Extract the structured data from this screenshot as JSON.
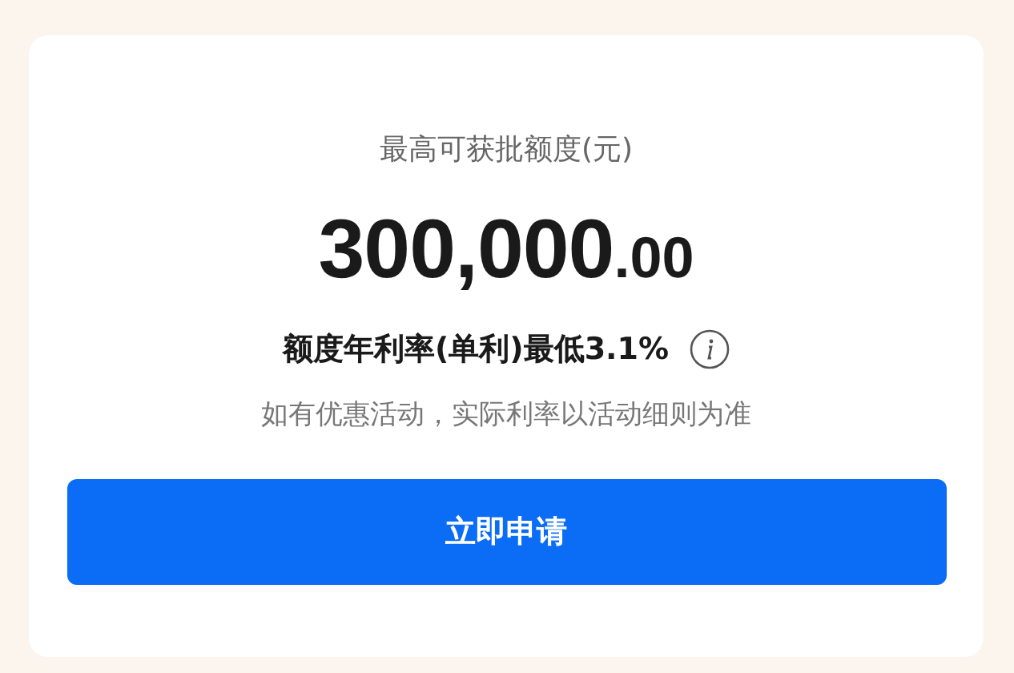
{
  "card": {
    "label": "最高可获批额度(元)",
    "amount_integer": "300,000",
    "amount_decimal": ".00",
    "rate_text": "额度年利率(单利)最低3.1%",
    "note": "如有优惠活动，实际利率以活动细则为准",
    "button": "立即申请"
  }
}
